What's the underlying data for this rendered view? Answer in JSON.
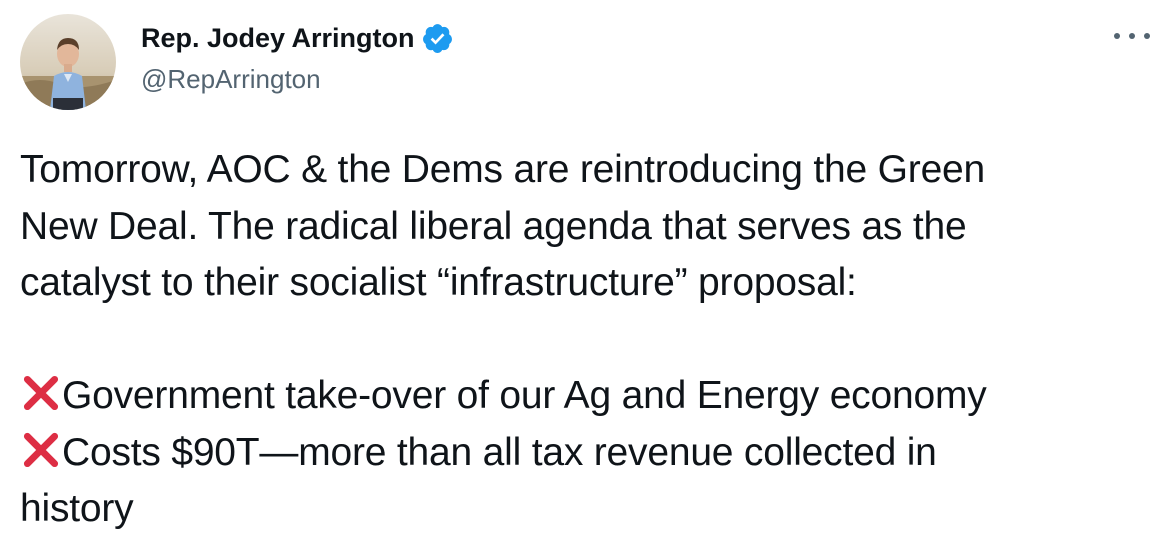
{
  "author": {
    "display_name": "Rep. Jodey Arrington",
    "handle": "@RepArrington",
    "avatar_icon": "profile-photo",
    "verified_icon": "verified-badge-icon",
    "verified_color": "#1d9bf0"
  },
  "menu": {
    "icon": "more-options-icon"
  },
  "tweet": {
    "lines": [
      "Tomorrow, AOC & the Dems are reintroducing the Green",
      "New Deal. The radical liberal agenda that serves as the",
      "catalyst to their socialist “infrastructure” proposal:"
    ],
    "bullets": [
      {
        "icon": "cross-mark-icon",
        "text": "Government take-over of our Ag and Energy economy"
      },
      {
        "icon": "cross-mark-icon",
        "text": "Costs $90T—more than all tax revenue collected in",
        "continuation": "history"
      }
    ],
    "cross_color": "#dd2e44"
  }
}
